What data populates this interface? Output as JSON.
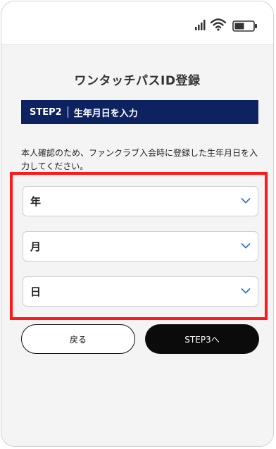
{
  "page": {
    "title": "ワンタッチパスID登録",
    "step_label": "STEP2",
    "step_title": "生年月日を入力",
    "description": "本人確認のため、ファンクラブ入会時に登録した生年月日を入力してください。"
  },
  "fields": [
    {
      "label": "年",
      "icon": "chevron-down-icon"
    },
    {
      "label": "月",
      "icon": "chevron-down-icon"
    },
    {
      "label": "日",
      "icon": "chevron-down-icon"
    }
  ],
  "buttons": {
    "back_label": "戻る",
    "next_label": "STEP3へ"
  },
  "status_icons": [
    "signal-icon",
    "wifi-icon",
    "battery-icon"
  ],
  "colors": {
    "step_bar": "#0c2261",
    "highlight": "#ff1a1a",
    "primary_button": "#0b0b0b",
    "chevron": "#2f6fd6"
  }
}
